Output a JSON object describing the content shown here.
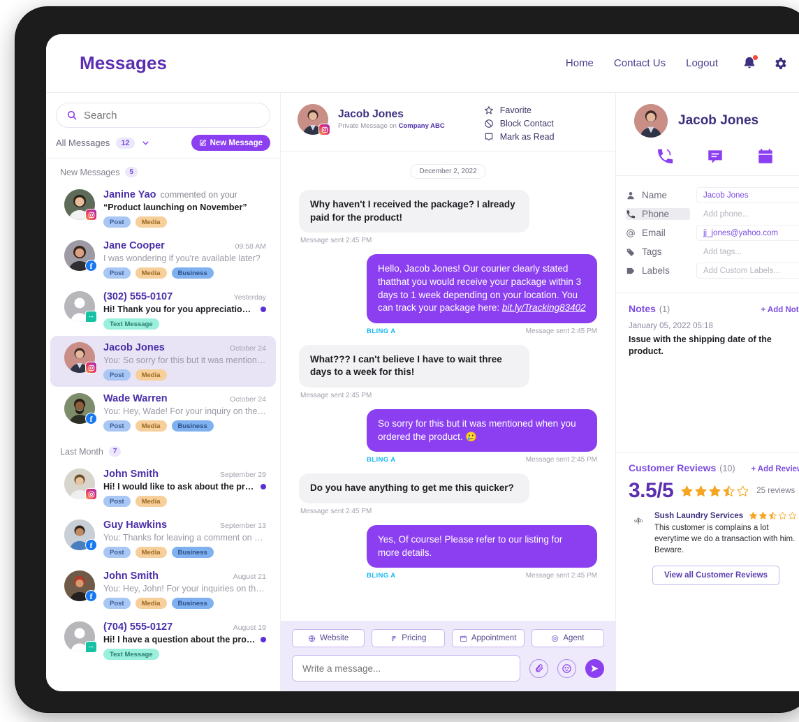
{
  "header": {
    "brand": "Messages",
    "nav": [
      {
        "label": "Home"
      },
      {
        "label": "Contact Us"
      },
      {
        "label": "Logout"
      }
    ],
    "icons": {
      "bell": "bell-icon",
      "gear": "gear-icon"
    }
  },
  "sidebar": {
    "search_placeholder": "Search",
    "search_value": "",
    "filter_label": "All Messages",
    "filter_count": "12",
    "new_message_label": "New Message",
    "groups": [
      {
        "title": "New Messages",
        "count": "5",
        "items": [
          {
            "name": "Janine Yao",
            "extra": "commented on your",
            "quoted": "“Product launching on November”",
            "snippet": "",
            "time": "",
            "platform": "instagram",
            "unread": false,
            "active": false,
            "bold": true,
            "tags": [
              "Post",
              "Media"
            ]
          },
          {
            "name": "Jane Cooper",
            "extra": "",
            "quoted": "",
            "snippet": "I was wondering if you're available later?",
            "time": "09:58 AM",
            "platform": "facebook",
            "unread": false,
            "active": false,
            "bold": false,
            "tags": [
              "Post",
              "Media",
              "Business"
            ]
          },
          {
            "name": "(302) 555-0107",
            "extra": "",
            "quoted": "",
            "snippet": "Hi! Thank you for you appreciation last night.",
            "time": "Yesterday",
            "platform": "sms",
            "unread": true,
            "active": false,
            "bold": true,
            "tags": [
              "Text Message"
            ]
          },
          {
            "name": "Jacob Jones",
            "extra": "",
            "quoted": "",
            "snippet": "You: So sorry for this but it was mentioned whe...",
            "time": "October 24",
            "platform": "instagram",
            "unread": false,
            "active": true,
            "bold": false,
            "tags": [
              "Post",
              "Media"
            ]
          },
          {
            "name": "Wade Warren",
            "extra": "",
            "quoted": "",
            "snippet": "You: Hey, Wade! For your inquiry on the job ...",
            "time": "October 24",
            "platform": "facebook",
            "unread": false,
            "active": false,
            "bold": false,
            "tags": [
              "Post",
              "Media",
              "Business"
            ]
          }
        ]
      },
      {
        "title": "Last Month",
        "count": "7",
        "items": [
          {
            "name": "John Smith",
            "extra": "",
            "quoted": "",
            "snippet": "Hi! I would like to ask about the product yo...",
            "time": "September 29",
            "platform": "instagram",
            "unread": true,
            "active": false,
            "bold": true,
            "tags": [
              "Post",
              "Media"
            ]
          },
          {
            "name": "Guy Hawkins",
            "extra": "",
            "quoted": "",
            "snippet": "You: Thanks for leaving a comment on our r...",
            "time": "September 13",
            "platform": "facebook",
            "unread": false,
            "active": false,
            "bold": false,
            "tags": [
              "Post",
              "Media",
              "Business"
            ]
          },
          {
            "name": "John Smith",
            "extra": "",
            "quoted": "",
            "snippet": "You: Hey, John! For your inquiries on the job...",
            "time": "August 21",
            "platform": "facebook",
            "unread": false,
            "active": false,
            "bold": false,
            "tags": [
              "Post",
              "Media",
              "Business"
            ]
          },
          {
            "name": "(704) 555-0127",
            "extra": "",
            "quoted": "",
            "snippet": "Hi! I have a question about the product that...",
            "time": "August 19",
            "platform": "sms",
            "unread": true,
            "active": false,
            "bold": true,
            "tags": [
              "Text Message"
            ]
          }
        ]
      }
    ]
  },
  "chat": {
    "contact_name": "Jacob Jones",
    "contact_sub_prefix": "Private Message on",
    "contact_sub_company": "Company ABC",
    "header_actions": [
      {
        "label": "Favorite",
        "icon": "star-icon"
      },
      {
        "label": "Block Contact",
        "icon": "block-icon"
      },
      {
        "label": "Mark as Read",
        "icon": "mark-read-icon"
      }
    ],
    "date_divider": "December 2, 2022",
    "messages": [
      {
        "dir": "in",
        "text": "Why haven't I received the package? I already paid for the product!",
        "meta": "Message sent 2:45 PM",
        "sender_tag": ""
      },
      {
        "dir": "out",
        "text": "Hello, Jacob Jones! Our courier clearly stated thatthat you would receive your package within 3 days to 1 week depending on your location. You can track your package here: ",
        "link": "bit.ly/Tracking83402",
        "meta": "Message sent 2:45 PM",
        "sender_tag": "BLING A"
      },
      {
        "dir": "in",
        "text": "What??? I can't believe I have to wait three days to a week for this!",
        "meta": "Message sent 2:45 PM",
        "sender_tag": ""
      },
      {
        "dir": "out",
        "text": "So sorry for this but it was mentioned when you ordered the product. 🥲",
        "meta": "Message sent 2:45 PM",
        "sender_tag": "BLING A"
      },
      {
        "dir": "in",
        "text": "Do you have anything to get me this quicker?",
        "meta": "Message sent 2:45 PM",
        "sender_tag": ""
      },
      {
        "dir": "out",
        "text": "Yes, Of course! Please refer to our listing for more details.",
        "meta": "Message sent 2:45 PM",
        "sender_tag": "BLING A"
      }
    ],
    "quick_buttons": [
      {
        "label": "Website",
        "icon": "globe-icon"
      },
      {
        "label": "Pricing",
        "icon": "pricing-icon"
      },
      {
        "label": "Appointment",
        "icon": "calendar-icon"
      },
      {
        "label": "Agent",
        "icon": "agent-icon"
      }
    ],
    "composer_placeholder": "Write a message...",
    "composer_value": "",
    "composer_icons": [
      "attach-icon",
      "emoji-icon",
      "send-icon"
    ]
  },
  "contact_panel": {
    "name": "Jacob Jones",
    "quick_actions": [
      "call-icon",
      "message-icon",
      "calendar-icon"
    ],
    "fields": [
      {
        "icon": "person-icon",
        "label": "Name",
        "value": "Jacob Jones",
        "placeholder": "",
        "filled": true,
        "highlight": false
      },
      {
        "icon": "phone-icon",
        "label": "Phone",
        "value": "",
        "placeholder": "Add phone...",
        "filled": false,
        "highlight": true
      },
      {
        "icon": "at-icon",
        "label": "Email",
        "value": "jj_jones@yahoo.com",
        "placeholder": "",
        "filled": true,
        "highlight": false
      },
      {
        "icon": "tag-icon",
        "label": "Tags",
        "value": "",
        "placeholder": "Add tags...",
        "filled": false,
        "highlight": false
      },
      {
        "icon": "label-icon",
        "label": "Labels",
        "value": "",
        "placeholder": "Add Custom Labels...",
        "filled": false,
        "highlight": false
      }
    ],
    "notes": {
      "title": "Notes",
      "count": "(1)",
      "add_label": "+ Add Note",
      "items": [
        {
          "date": "January 05, 2022 05:18",
          "text": "Issue with the shipping date of the product."
        }
      ]
    },
    "reviews": {
      "title": "Customer Reviews",
      "count": "(10)",
      "add_label": "+ Add Review",
      "score": "3.5/5",
      "score_stars": 3.5,
      "total_label": "25 reviews",
      "items": [
        {
          "reviewer": "Sush Laundry Services",
          "stars": 2.5,
          "text": "This customer is complains a lot everytime we do a transaction with him. Beware."
        }
      ],
      "view_all_label": "View all Customer Reviews"
    }
  },
  "colors": {
    "brand_purple": "#5b2fb0",
    "accent_purple": "#8b3ff0",
    "bubble_in": "#f2f2f4",
    "bling_blue": "#16b8f3",
    "star_orange": "#f5a623",
    "unread_dot": "#5b2fd8",
    "notification_red": "#f8453c"
  }
}
